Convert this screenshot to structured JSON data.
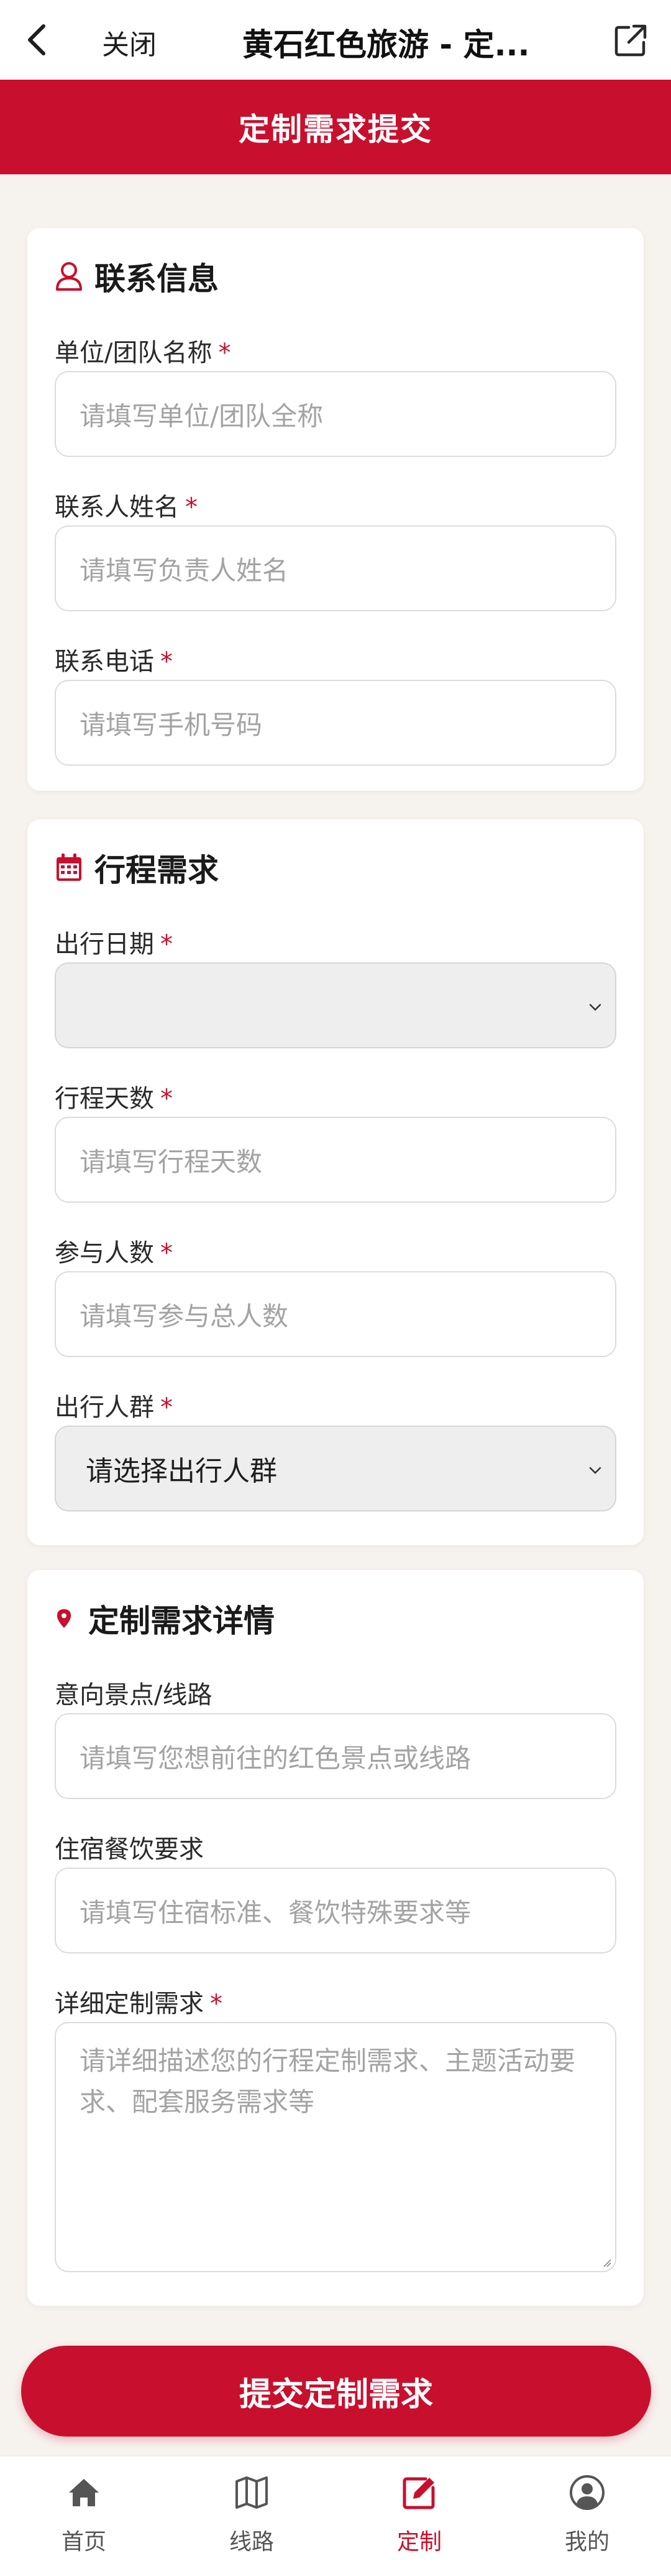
{
  "topbar": {
    "close_label": "关闭",
    "title": "黄石红色旅游 - 定..."
  },
  "header": {
    "title": "定制需求提交"
  },
  "contact_section": {
    "title": "联系信息",
    "icon": "user-icon",
    "fields": [
      {
        "label": "单位/团队名称",
        "required": "*",
        "placeholder": "请填写单位/团队全称"
      },
      {
        "label": "联系人姓名",
        "required": "*",
        "placeholder": "请填写负责人姓名"
      },
      {
        "label": "联系电话",
        "required": "*",
        "placeholder": "请填写手机号码"
      }
    ]
  },
  "trip_section": {
    "title": "行程需求",
    "icon": "calendar-icon",
    "date": {
      "label": "出行日期",
      "required": "*",
      "value": ""
    },
    "days": {
      "label": "行程天数",
      "required": "*",
      "placeholder": "请填写行程天数"
    },
    "people": {
      "label": "参与人数",
      "required": "*",
      "placeholder": "请填写参与总人数"
    },
    "group": {
      "label": "出行人群",
      "required": "*",
      "selected": "请选择出行人群"
    }
  },
  "detail_section": {
    "title": "定制需求详情",
    "icon": "location-pin-icon",
    "spots": {
      "label": "意向景点/线路",
      "placeholder": "请填写您想前往的红色景点或线路"
    },
    "lodging": {
      "label": "住宿餐饮要求",
      "placeholder": "请填写住宿标准、餐饮特殊要求等"
    },
    "detail": {
      "label": "详细定制需求",
      "required": "*",
      "placeholder": "请详细描述您的行程定制需求、主题活动要求、配套服务需求等"
    }
  },
  "submit_label": "提交定制需求",
  "tabbar": {
    "items": [
      {
        "label": "首页",
        "icon": "home-icon"
      },
      {
        "label": "线路",
        "icon": "map-icon"
      },
      {
        "label": "定制",
        "icon": "edit-icon"
      },
      {
        "label": "我的",
        "icon": "profile-icon"
      }
    ],
    "active_index": 2
  },
  "colors": {
    "brand_red": "#c8102e",
    "background": "#f6f2ee"
  }
}
